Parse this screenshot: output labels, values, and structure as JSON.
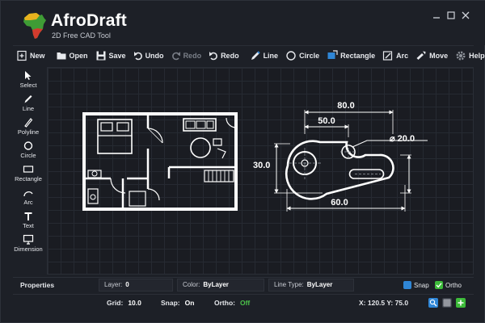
{
  "app": {
    "title": "AfroDraft",
    "subtitle": "2D Free CAD Tool",
    "window_controls": [
      "minimize-icon",
      "maximize-icon",
      "close-icon"
    ]
  },
  "toolbar": {
    "new": "New",
    "open": "Open",
    "save": "Save",
    "undo": "Undo",
    "redo_disabled": "Redo",
    "redo": "Redo",
    "line": "Line",
    "circle": "Circle",
    "rectangle": "Rectangle",
    "arc": "Arc",
    "move": "Move",
    "help": "Help"
  },
  "tools": {
    "select": "Select",
    "line": "Line",
    "polyline": "Polyline",
    "circle": "Circle",
    "rectangle": "Rectangle",
    "arc": "Arc",
    "text": "Text",
    "dimension": "Dimension"
  },
  "drawing": {
    "dimensions": {
      "d80": "80.0",
      "d50": "50.0",
      "diameter": "⌀ 20.0",
      "d30": "30.0",
      "d60": "60.0"
    }
  },
  "properties": {
    "title": "Properties",
    "layer_label": "Layer:",
    "layer_value": "0",
    "color_label": "Color:",
    "color_value": "ByLayer",
    "linetype_label": "Line Type:",
    "linetype_value": "ByLayer",
    "snap_label": "Snap",
    "ortho_label": "Ortho"
  },
  "status": {
    "grid_label": "Grid:",
    "grid_value": "10.0",
    "snap_label": "Snap:",
    "snap_value": "On",
    "ortho_label": "Ortho:",
    "ortho_value": "Off",
    "coords": "X: 120.5 Y: 75.0"
  },
  "colors": {
    "accent_blue": "#2f86d6",
    "accent_green": "#3dbb3a",
    "background": "#1d2027"
  }
}
